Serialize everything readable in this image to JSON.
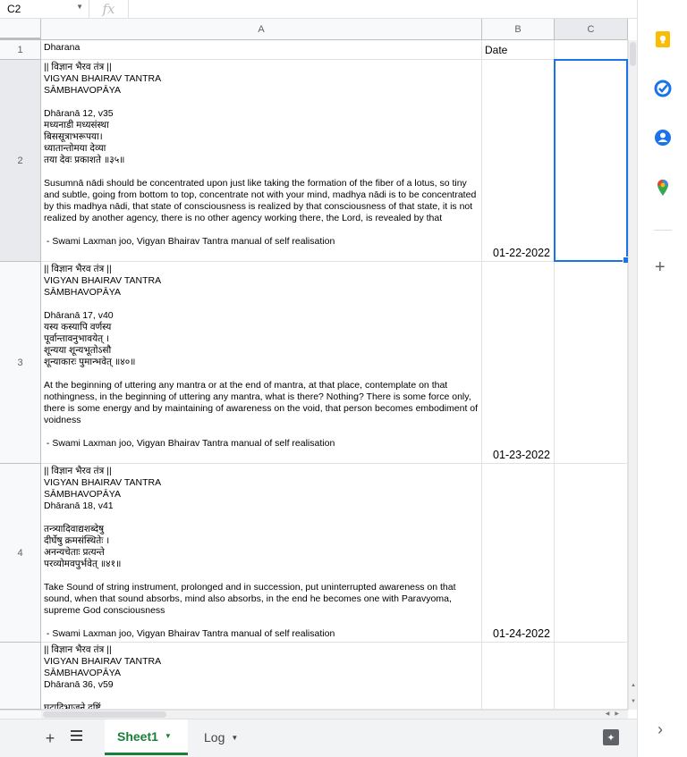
{
  "formula_bar": {
    "cell_ref": "C2",
    "fx": "fx"
  },
  "columns": [
    "A",
    "B",
    "C"
  ],
  "row_numbers": [
    "1",
    "2",
    "3",
    "4",
    ""
  ],
  "header": {
    "col_a": "Dharana",
    "col_b": "Date"
  },
  "rows": [
    {
      "lines": [
        "|| विज्ञान भैरव तंत्र ||",
        "VIGYAN BHAIRAV TANTRA",
        "SĀMBHAVOPĀYA",
        "",
        "Dhāranā 12, v35",
        "मध्यनाडी मध्यसंस्था",
        "बिससूत्राभरूपया।",
        "ध्यातान्तोमया देव्या",
        "तया देवः प्रकाशते ॥३५॥",
        ""
      ],
      "text": "Susumnā nādi should be concentrated upon just like taking the formation of the fiber of a lotus, so tiny and subtle, going from bottom to top, concentrate not with your mind, madhya nādi is to be concentrated by this madhya nādi, that state of consciousness is realized by that consciousness of that state, it is not realized by another agency, there is no other agency working there, the Lord, is revealed by that",
      "credit": " - Swami Laxman joo, Vigyan Bhairav Tantra manual of self realisation",
      "date": "01-22-2022"
    },
    {
      "lines": [
        "|| विज्ञान भैरव तंत्र ||",
        "VIGYAN BHAIRAV TANTRA",
        "SĀMBHAVOPĀYA",
        "",
        "Dhāranā 17, v40",
        "यस्य कस्यापि वर्णस्य",
        "पूर्वान्तावनुभावयेत् ।",
        "शून्यया शून्यभूतोऽसौ",
        "शून्याकारः पुमान्भवेत् ॥४०॥",
        ""
      ],
      "text": "At the beginning of uttering any mantra or at the end of mantra, at that place, contemplate on that nothingness, in the beginning of uttering any mantra, what is there? Nothing? There is some force only, there is some energy and by maintaining of awareness on the void, that person becomes embodiment of voidness",
      "credit": " - Swami Laxman joo, Vigyan Bhairav Tantra manual of self realisation",
      "date": "01-23-2022"
    },
    {
      "lines": [
        "|| विज्ञान भैरव तंत्र ||",
        "VIGYAN BHAIRAV TANTRA",
        "SĀMBHAVOPĀYA",
        "Dhāranā 18, v41",
        "",
        "तन्त्र्यादिवाद्यशब्देषु",
        "दीर्घेषु क्रमसंस्थितेः ।",
        "अनन्यचेताः प्रत्यन्ते",
        "परव्योमवपुर्भवेत् ॥४१॥",
        ""
      ],
      "text": "Take Sound of string instrument, prolonged and in succession, put uninterrupted awareness on that sound, when that sound absorbs, mind also absorbs, in the end he becomes one with Paravyoma, supreme God consciousness",
      "credit": " - Swami Laxman joo, Vigyan Bhairav Tantra manual of self realisation",
      "date": "01-24-2022"
    },
    {
      "lines": [
        "|| विज्ञान भैरव तंत्र ||",
        "VIGYAN BHAIRAV TANTRA",
        "SĀMBHAVOPĀYA",
        "Dhāranā 36, v59",
        "",
        "घटादिभाजने दृष्टिं"
      ],
      "text": "",
      "credit": "",
      "date": ""
    }
  ],
  "sheets": [
    {
      "name": "Sheet1",
      "active": true
    },
    {
      "name": "Log",
      "active": false
    }
  ],
  "side_icons": [
    "keep-icon",
    "tasks-icon",
    "contacts-icon",
    "maps-icon"
  ],
  "colors": {
    "accent": "#1a73e8",
    "sheet_active": "#188038"
  }
}
